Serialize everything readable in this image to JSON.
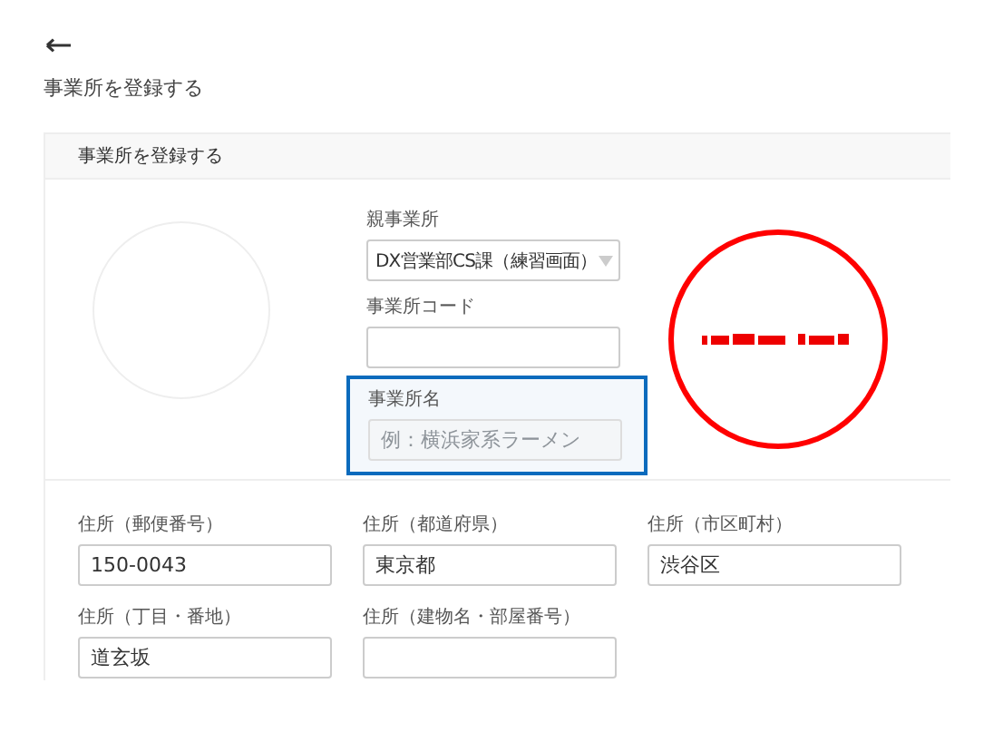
{
  "page_title": "事業所を登録する",
  "card": {
    "title": "事業所を登録する",
    "parent_office": {
      "label": "親事業所",
      "value": "DX営業部CS課（練習画面）"
    },
    "office_code": {
      "label": "事業所コード"
    },
    "office_name": {
      "label": "事業所名",
      "placeholder": "例：横浜家系ラーメン",
      "focused": true,
      "disabled": true
    },
    "address_fields": [
      {
        "label": "住所（郵便番号）",
        "value": "150-0043"
      },
      {
        "label": "住所（都道府県）",
        "value": "東京都"
      },
      {
        "label": "住所（市区町村）",
        "value": "渋谷区"
      },
      {
        "label": "住所（丁目・番地）",
        "value": "道玄坂"
      },
      {
        "label": "住所（建物名・部屋番号）"
      }
    ]
  }
}
